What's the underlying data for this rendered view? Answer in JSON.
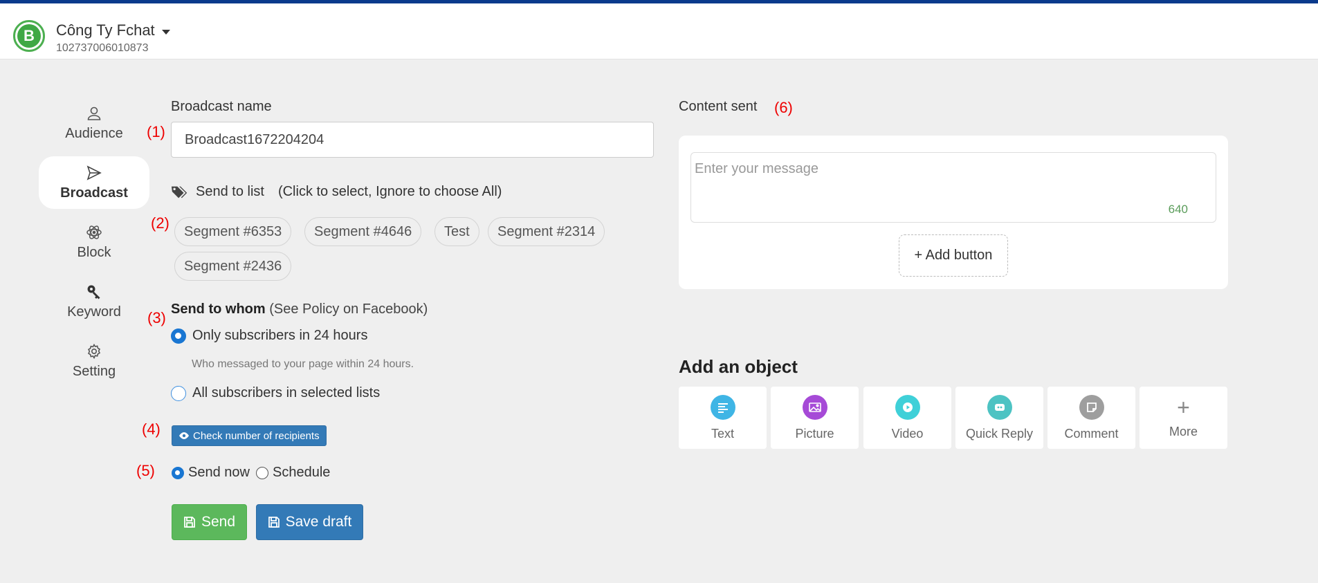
{
  "header": {
    "company_name": "Công Ty Fchat",
    "company_id": "102737006010873",
    "logo_letter": "B"
  },
  "sidebar": {
    "items": [
      {
        "label": "Audience",
        "icon": "user-icon",
        "active": false
      },
      {
        "label": "Broadcast",
        "icon": "send-icon",
        "active": true
      },
      {
        "label": "Block",
        "icon": "atom-icon",
        "active": false
      },
      {
        "label": "Keyword",
        "icon": "key-icon",
        "active": false
      },
      {
        "label": "Setting",
        "icon": "gear-icon",
        "active": false
      }
    ]
  },
  "annotations": [
    "(1)",
    "(2)",
    "(3)",
    "(4)",
    "(5)",
    "(6)"
  ],
  "form": {
    "name_label": "Broadcast name",
    "name_value": "Broadcast1672204204",
    "send_to_list_label": "Send to list",
    "send_to_list_hint": "(Click to select, Ignore to choose All)",
    "segments": [
      "Segment #6353",
      "Segment #4646",
      "Test",
      "Segment #2314",
      "Segment #2436"
    ],
    "whom_label": "Send to whom",
    "whom_hint": "(See Policy on Facebook)",
    "option_24h": "Only subscribers in 24 hours",
    "option_24h_hint": "Who messaged to your page within 24 hours.",
    "option_all": "All subscribers in selected lists",
    "check_button": "Check number of recipients",
    "send_now": "Send now",
    "schedule": "Schedule",
    "send_button": "Send",
    "save_draft_button": "Save draft"
  },
  "content": {
    "label": "Content sent",
    "message_placeholder": "Enter your message",
    "char_count": "640",
    "add_button": "+ Add button"
  },
  "objects": {
    "title": "Add an object",
    "items": [
      {
        "label": "Text",
        "icon": "text-icon",
        "color": "#3fb5e5"
      },
      {
        "label": "Picture",
        "icon": "picture-icon",
        "color": "#a64ad7"
      },
      {
        "label": "Video",
        "icon": "video-icon",
        "color": "#3fd0d8"
      },
      {
        "label": "Quick Reply",
        "icon": "quick-reply-icon",
        "color": "#4dc3c3"
      },
      {
        "label": "Comment",
        "icon": "comment-icon",
        "color": "#9e9e9e"
      },
      {
        "label": "More",
        "icon": "plus-icon",
        "color": "#888888"
      }
    ]
  }
}
